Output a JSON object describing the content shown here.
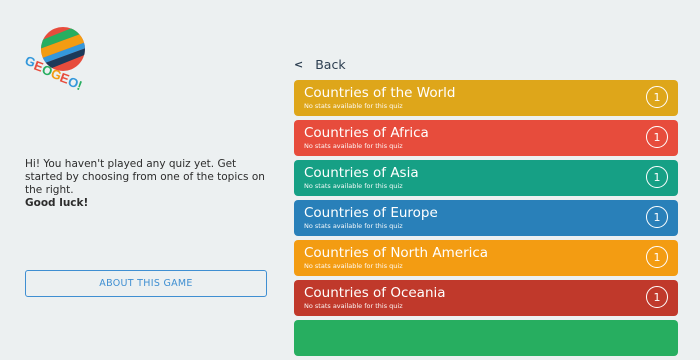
{
  "logo": {
    "text": "GEOGEO!",
    "alt": "GeoGeo logo"
  },
  "intro": {
    "text": "Hi! You haven't played any quiz yet. Get started by choosing from one of the topics on the right.",
    "good_luck": "Good luck!"
  },
  "about_button": "ABOUT THIS GAME",
  "back": {
    "icon": "chevron-left-icon",
    "glyph": "<",
    "label": "Back"
  },
  "quizzes": [
    {
      "title": "Countries of the World",
      "subtitle": "No stats available for this quiz",
      "count": "1",
      "color": "#dea61a"
    },
    {
      "title": "Countries of Africa",
      "subtitle": "No stats available for this quiz",
      "count": "1",
      "color": "#e74c3c"
    },
    {
      "title": "Countries of Asia",
      "subtitle": "No stats available for this quiz",
      "count": "1",
      "color": "#16a085"
    },
    {
      "title": "Countries of Europe",
      "subtitle": "No stats available for this quiz",
      "count": "1",
      "color": "#2980b9"
    },
    {
      "title": "Countries of North America",
      "subtitle": "No stats available for this quiz",
      "count": "1",
      "color": "#f39c12"
    },
    {
      "title": "Countries of Oceania",
      "subtitle": "No stats available for this quiz",
      "count": "1",
      "color": "#c0392b"
    },
    {
      "title": "",
      "subtitle": "",
      "count": "",
      "color": "#27ae60"
    }
  ]
}
